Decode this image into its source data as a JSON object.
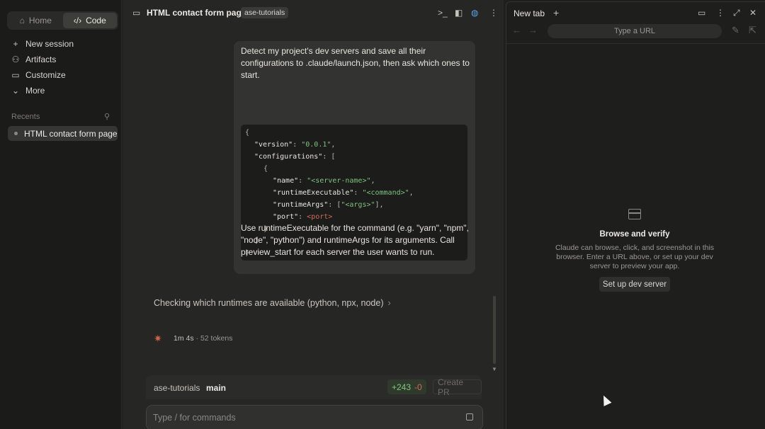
{
  "sidebar": {
    "segment": {
      "home": "Home",
      "code": "Code"
    },
    "nav": [
      {
        "icon": "plus-icon",
        "label": "New session"
      },
      {
        "icon": "artifacts-icon",
        "label": "Artifacts"
      },
      {
        "icon": "customize-icon",
        "label": "Customize"
      },
      {
        "icon": "chevron-down-icon",
        "label": "More"
      }
    ],
    "recents_label": "Recents",
    "recents": [
      {
        "label": "HTML contact form page"
      }
    ]
  },
  "main": {
    "title": "HTML contact form page",
    "project_badge": "ase-tutorials",
    "message": {
      "intro": "Detect my project's dev servers and save all their configurations to .claude/launch.json, then ask which ones to start.",
      "code": {
        "open_brace": "{",
        "version_key": "\"version\"",
        "version_val": "\"0.0.1\"",
        "configs_key": "\"configurations\"",
        "open_bracket": "[",
        "obj_open": "{",
        "name_key": "\"name\"",
        "name_val": "\"<server-name>\"",
        "rt_exec_key": "\"runtimeExecutable\"",
        "rt_exec_val": "\"<command>\"",
        "rt_args_key": "\"runtimeArgs\"",
        "rt_args_val": "\"<args>\"",
        "port_key": "\"port\"",
        "port_val": "<port>",
        "obj_close": "}",
        "close_bracket": "]",
        "close_brace": "}"
      },
      "outro": "Use runtimeExecutable for the command (e.g. \"yarn\", \"npm\", \"node\", \"python\") and runtimeArgs for its arguments. Call preview_start for each server the user wants to run."
    },
    "status": "Checking which runtimes are available (python, npx, node)",
    "elapsed": "1m 4s",
    "tokens": "52 tokens",
    "branch": {
      "repo": "ase-tutorials",
      "name": "main",
      "additions": "+243",
      "deletions": "-0",
      "pr_label": "Create PR"
    },
    "composer": {
      "placeholder": "Type / for commands"
    }
  },
  "browser": {
    "tab_title": "New tab",
    "url_placeholder": "Type a URL",
    "empty_title": "Browse and verify",
    "empty_desc": "Claude can browse, click, and screenshot in this browser. Enter a URL above, or set up your dev server to preview your app.",
    "setup_button": "Set up dev server"
  }
}
